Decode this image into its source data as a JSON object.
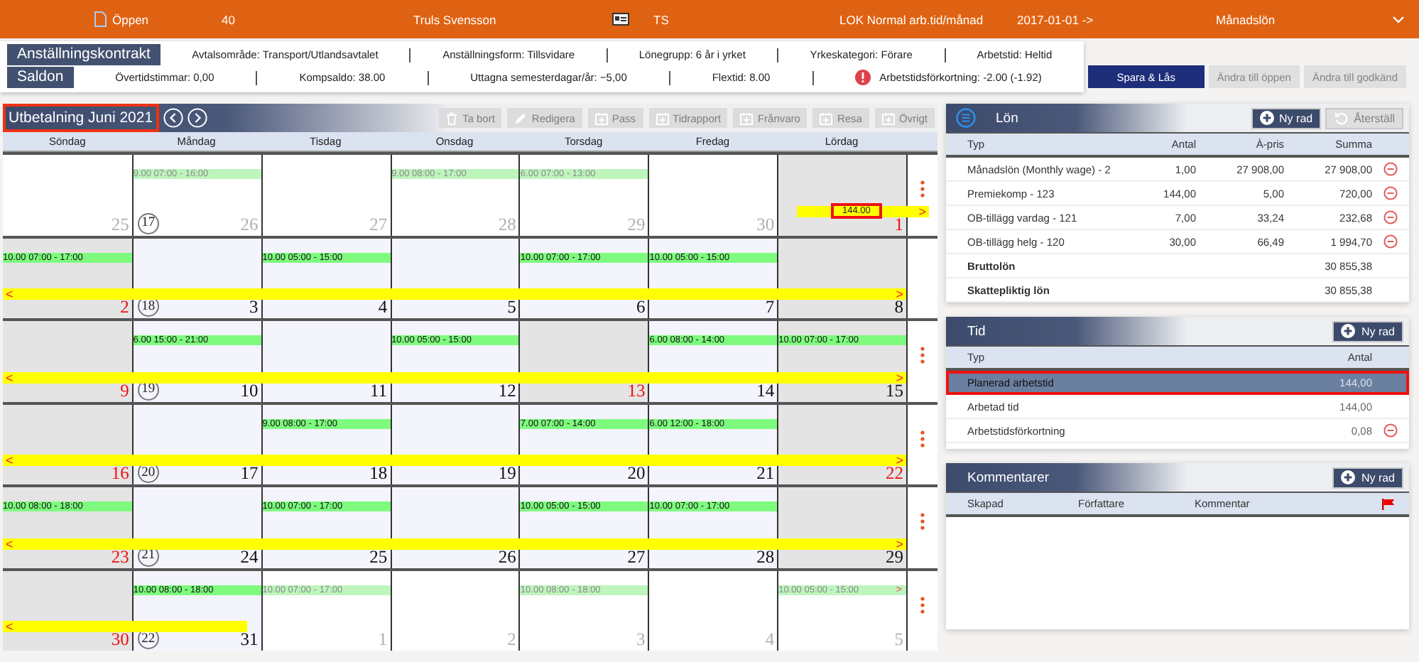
{
  "top_bar": {
    "fields": [
      {
        "kind": "status",
        "text": "Öppen"
      },
      {
        "kind": "plain",
        "text": "40"
      },
      {
        "kind": "plain",
        "text": "Truls Svensson"
      },
      {
        "kind": "id",
        "text": "TS"
      },
      {
        "kind": "plain",
        "text": "LOK Normal arb.tid/månad"
      },
      {
        "kind": "plain",
        "text": "2017-01-01 ->"
      },
      {
        "kind": "plain",
        "text": "Månadslön"
      }
    ]
  },
  "contract": {
    "label": "Anställningskontrakt",
    "fields": [
      {
        "text": "Avtalsområde: Transport/Utlandsavtalet",
        "warning": false
      },
      {
        "text": "Anställningsform: Tillsvidare",
        "warning": false
      },
      {
        "text": "Lönegrupp: 6 år i yrket",
        "warning": false
      },
      {
        "text": "Yrkeskategori: Förare",
        "warning": false
      },
      {
        "text": "Arbetstid: Heltid",
        "warning": false
      }
    ]
  },
  "balances": {
    "label": "Saldon",
    "fields": [
      {
        "text": "Övertidstimmar: 0,00",
        "warning": false
      },
      {
        "text": "Kompsaldo: 38.00",
        "warning": false
      },
      {
        "text": "Uttagna semesterdagar/år: −5,00",
        "warning": false
      },
      {
        "text": "Flextid: 8.00",
        "warning": false
      },
      {
        "text": "Arbetstidsförkortning: -2.00 (-1.92)",
        "warning": true
      }
    ]
  },
  "actions": [
    {
      "label": "Spara & Lås",
      "disabled": false
    },
    {
      "label": "Ändra till öppen",
      "disabled": true
    },
    {
      "label": "Ändra till godkänd",
      "disabled": true
    }
  ],
  "calendar": {
    "title": "Utbetalning Juni 2021",
    "outlined": true,
    "toolbar": [
      {
        "kind": "delete",
        "label": "Ta bort",
        "disabled": true
      },
      {
        "kind": "edit",
        "label": "Redigera",
        "disabled": true
      },
      {
        "kind": "add",
        "label": "Pass",
        "disabled": true
      },
      {
        "kind": "add",
        "label": "Tidrapport",
        "disabled": true
      },
      {
        "kind": "add",
        "label": "Frånvaro",
        "disabled": true
      },
      {
        "kind": "add",
        "label": "Resa",
        "disabled": true
      },
      {
        "kind": "add",
        "label": "Övrigt",
        "disabled": true
      }
    ],
    "weekdays": [
      "Söndag",
      "Måndag",
      "Tisdag",
      "Onsdag",
      "Torsdag",
      "Fredag",
      "Lördag"
    ],
    "weeks": [
      {
        "week": "17",
        "menu": true,
        "bar": {
          "kind": "end",
          "right": ">",
          "label": "144.00",
          "label_outlined": true
        },
        "days": [
          {
            "date": "25",
            "kind": "other",
            "holiday": false
          },
          {
            "date": "26",
            "kind": "other",
            "holiday": false,
            "shifts": [
              {
                "text": "9.00 07:00 - 16:00",
                "faded": true
              }
            ]
          },
          {
            "date": "27",
            "kind": "other",
            "holiday": false
          },
          {
            "date": "28",
            "kind": "other",
            "holiday": false,
            "shifts": [
              {
                "text": "9.00 08:00 - 17:00",
                "faded": true
              }
            ]
          },
          {
            "date": "29",
            "kind": "other",
            "holiday": false,
            "shifts": [
              {
                "text": "6.00 07:00 - 13:00",
                "faded": true
              }
            ]
          },
          {
            "date": "30",
            "kind": "other",
            "holiday": false
          },
          {
            "date": "1",
            "kind": "weekend",
            "holiday": true
          }
        ]
      },
      {
        "week": "18",
        "menu": false,
        "bar": {
          "kind": "full",
          "left": "<",
          "right": ">"
        },
        "days": [
          {
            "date": "2",
            "kind": "weekend",
            "holiday": true,
            "shifts": [
              {
                "text": "10.00 07:00 - 17:00",
                "faded": false
              }
            ]
          },
          {
            "date": "3",
            "kind": "weekday",
            "holiday": false
          },
          {
            "date": "4",
            "kind": "weekday",
            "holiday": false,
            "shifts": [
              {
                "text": "10.00 05:00 - 15:00",
                "faded": false
              }
            ]
          },
          {
            "date": "5",
            "kind": "weekday",
            "holiday": false
          },
          {
            "date": "6",
            "kind": "weekday",
            "holiday": false,
            "shifts": [
              {
                "text": "10.00 07:00 - 17:00",
                "faded": false
              }
            ]
          },
          {
            "date": "7",
            "kind": "weekday",
            "holiday": false,
            "shifts": [
              {
                "text": "10.00 05:00 - 15:00",
                "faded": false
              }
            ]
          },
          {
            "date": "8",
            "kind": "weekend",
            "holiday": false
          }
        ]
      },
      {
        "week": "19",
        "menu": true,
        "bar": {
          "kind": "full",
          "left": "<",
          "right": ">"
        },
        "days": [
          {
            "date": "9",
            "kind": "weekend",
            "holiday": true
          },
          {
            "date": "10",
            "kind": "weekday",
            "holiday": false,
            "shifts": [
              {
                "text": "6.00 15:00 - 21:00",
                "faded": false
              }
            ]
          },
          {
            "date": "11",
            "kind": "weekday",
            "holiday": false
          },
          {
            "date": "12",
            "kind": "weekday",
            "holiday": false,
            "shifts": [
              {
                "text": "10.00 05:00 - 15:00",
                "faded": false
              }
            ]
          },
          {
            "date": "13",
            "kind": "weekend",
            "holiday": true
          },
          {
            "date": "14",
            "kind": "weekday",
            "holiday": false,
            "shifts": [
              {
                "text": "6.00 08:00 - 14:00",
                "faded": false
              }
            ]
          },
          {
            "date": "15",
            "kind": "weekend",
            "holiday": false,
            "shifts": [
              {
                "text": "10.00 07:00 - 17:00",
                "faded": false
              }
            ]
          }
        ]
      },
      {
        "week": "20",
        "menu": true,
        "bar": {
          "kind": "full",
          "left": "<",
          "right": ">"
        },
        "days": [
          {
            "date": "16",
            "kind": "weekend",
            "holiday": true
          },
          {
            "date": "17",
            "kind": "weekday",
            "holiday": false
          },
          {
            "date": "18",
            "kind": "weekday",
            "holiday": false,
            "shifts": [
              {
                "text": "9.00 08:00 - 17:00",
                "faded": false
              }
            ]
          },
          {
            "date": "19",
            "kind": "weekday",
            "holiday": false
          },
          {
            "date": "20",
            "kind": "weekday",
            "holiday": false,
            "shifts": [
              {
                "text": "7.00 07:00 - 14:00",
                "faded": false
              }
            ]
          },
          {
            "date": "21",
            "kind": "weekday",
            "holiday": false,
            "shifts": [
              {
                "text": "6.00 12:00 - 18:00",
                "faded": false
              }
            ]
          },
          {
            "date": "22",
            "kind": "weekend",
            "holiday": true
          }
        ]
      },
      {
        "week": "21",
        "menu": true,
        "bar": {
          "kind": "full",
          "left": "<",
          "right": ">"
        },
        "days": [
          {
            "date": "23",
            "kind": "weekend",
            "holiday": true,
            "shifts": [
              {
                "text": "10.00 08:00 - 18:00",
                "faded": false
              }
            ]
          },
          {
            "date": "24",
            "kind": "weekday",
            "holiday": false
          },
          {
            "date": "25",
            "kind": "weekday",
            "holiday": false,
            "shifts": [
              {
                "text": "10.00 07:00 - 17:00",
                "faded": false
              }
            ]
          },
          {
            "date": "26",
            "kind": "weekday",
            "holiday": false
          },
          {
            "date": "27",
            "kind": "weekday",
            "holiday": false,
            "shifts": [
              {
                "text": "10.00 05:00 - 15:00",
                "faded": false
              }
            ]
          },
          {
            "date": "28",
            "kind": "weekday",
            "holiday": false,
            "shifts": [
              {
                "text": "10.00 07:00 - 17:00",
                "faded": false
              }
            ]
          },
          {
            "date": "29",
            "kind": "weekend",
            "holiday": false
          }
        ]
      },
      {
        "week": "22",
        "menu": true,
        "bar": {
          "kind": "start",
          "left": "<"
        },
        "days": [
          {
            "date": "30",
            "kind": "weekend",
            "holiday": true
          },
          {
            "date": "31",
            "kind": "weekday",
            "holiday": false,
            "shifts": [
              {
                "text": "10.00 08:00 - 18:00",
                "faded": false
              }
            ]
          },
          {
            "date": "1",
            "kind": "other",
            "holiday": false,
            "shifts": [
              {
                "text": "10.00 07:00 - 17:00",
                "faded": true
              }
            ]
          },
          {
            "date": "2",
            "kind": "other",
            "holiday": false
          },
          {
            "date": "3",
            "kind": "other",
            "holiday": false,
            "shifts": [
              {
                "text": "10.00 08:00 - 18:00",
                "faded": true
              }
            ]
          },
          {
            "date": "4",
            "kind": "other",
            "holiday": false
          },
          {
            "date": "5",
            "kind": "other",
            "holiday": false,
            "shifts": [
              {
                "text": "10.00 05:00 - 15:00",
                "faded": true,
                "more": ">"
              }
            ]
          }
        ]
      }
    ]
  },
  "salary": {
    "kind": "salary",
    "title": "Lön",
    "buttons": [
      {
        "kind": "add",
        "label": "Ny rad",
        "disabled": false
      },
      {
        "kind": "reset",
        "label": "Återställ",
        "disabled": true
      }
    ],
    "columns": [
      "Typ",
      "Antal",
      "À-pris",
      "Summa"
    ],
    "rows": [
      {
        "kind": "item",
        "type": "Månadslön (Monthly wage) - 2",
        "count": "1,00",
        "price": "27 908,00",
        "sum": "27 908,00",
        "removable": true
      },
      {
        "kind": "item",
        "type": "Premiekomp - 123",
        "count": "144,00",
        "price": "5,00",
        "sum": "720,00",
        "removable": true
      },
      {
        "kind": "item",
        "type": "OB-tillägg vardag - 121",
        "count": "7,00",
        "price": "33,24",
        "sum": "232,68",
        "removable": true
      },
      {
        "kind": "item",
        "type": "OB-tillägg helg - 120",
        "count": "30,00",
        "price": "66,49",
        "sum": "1 994,70",
        "removable": true
      },
      {
        "kind": "total",
        "type": "Bruttolön",
        "sum": "30 855,38"
      },
      {
        "kind": "total",
        "type": "Skattepliktig lön",
        "sum": "30 855,38"
      }
    ]
  },
  "time": {
    "kind": "time",
    "title": "Tid",
    "buttons": [
      {
        "kind": "add",
        "label": "Ny rad",
        "disabled": false
      }
    ],
    "columns": [
      "Typ",
      "Antal"
    ],
    "rows": [
      {
        "type": "Planerad arbetstid",
        "count": "144,00",
        "selected": true,
        "outlined": true,
        "removable": false
      },
      {
        "type": "Arbetad tid",
        "count": "144,00",
        "selected": false,
        "outlined": false,
        "removable": false
      },
      {
        "type": "Arbetstidsförkortning",
        "count": "0,08",
        "selected": false,
        "outlined": false,
        "removable": true
      }
    ]
  },
  "comments": {
    "kind": "comments",
    "title": "Kommentarer",
    "buttons": [
      {
        "kind": "add",
        "label": "Ny rad",
        "disabled": false
      }
    ],
    "columns": [
      "Skapad",
      "Författare",
      "Kommentar"
    ]
  }
}
